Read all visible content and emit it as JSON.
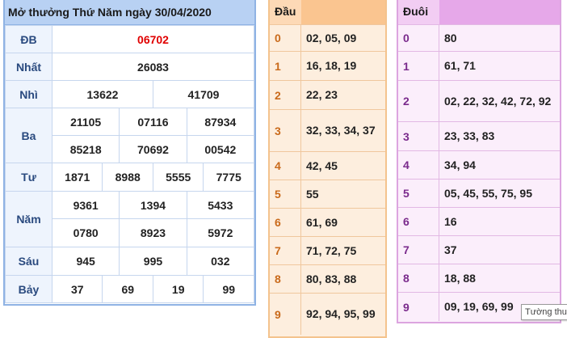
{
  "results": {
    "title": "Mở thưởng Thứ Năm ngày 30/04/2020",
    "prizes": {
      "db": {
        "label": "ĐB",
        "values": [
          "06702"
        ]
      },
      "nhat": {
        "label": "Nhất",
        "values": [
          "26083"
        ]
      },
      "nhi": {
        "label": "Nhì",
        "values": [
          "13622",
          "41709"
        ]
      },
      "ba": {
        "label": "Ba",
        "values": [
          "21105",
          "07116",
          "87934",
          "85218",
          "70692",
          "00542"
        ]
      },
      "tu": {
        "label": "Tư",
        "values": [
          "1871",
          "8988",
          "5555",
          "7775"
        ]
      },
      "nam": {
        "label": "Năm",
        "values": [
          "9361",
          "1394",
          "5433",
          "0780",
          "8923",
          "5972"
        ]
      },
      "sau": {
        "label": "Sáu",
        "values": [
          "945",
          "995",
          "032"
        ]
      },
      "bay": {
        "label": "Bảy",
        "values": [
          "37",
          "69",
          "19",
          "99"
        ]
      }
    },
    "highlight_color": "#e00000"
  },
  "dau": {
    "header": [
      "Đầu",
      ""
    ],
    "rows": [
      {
        "digit": "0",
        "nums": "02, 05, 09"
      },
      {
        "digit": "1",
        "nums": "16, 18, 19"
      },
      {
        "digit": "2",
        "nums": "22, 23"
      },
      {
        "digit": "3",
        "nums": "32, 33, 34, 37"
      },
      {
        "digit": "4",
        "nums": "42, 45"
      },
      {
        "digit": "5",
        "nums": "55"
      },
      {
        "digit": "6",
        "nums": "61, 69"
      },
      {
        "digit": "7",
        "nums": "71, 72, 75"
      },
      {
        "digit": "8",
        "nums": "80, 83, 88"
      },
      {
        "digit": "9",
        "nums": "92, 94, 95, 99"
      }
    ]
  },
  "duoi": {
    "header": [
      "Đuôi",
      ""
    ],
    "rows": [
      {
        "digit": "0",
        "nums": "80"
      },
      {
        "digit": "1",
        "nums": "61, 71"
      },
      {
        "digit": "2",
        "nums": "02, 22, 32, 42, 72, 92"
      },
      {
        "digit": "3",
        "nums": "23, 33, 83"
      },
      {
        "digit": "4",
        "nums": "34, 94"
      },
      {
        "digit": "5",
        "nums": "05, 45, 55, 75, 95"
      },
      {
        "digit": "6",
        "nums": "16"
      },
      {
        "digit": "7",
        "nums": "37"
      },
      {
        "digit": "8",
        "nums": "18, 88"
      },
      {
        "digit": "9",
        "nums": "09, 19, 69, 99"
      }
    ]
  },
  "tooltip": "Tường thu"
}
